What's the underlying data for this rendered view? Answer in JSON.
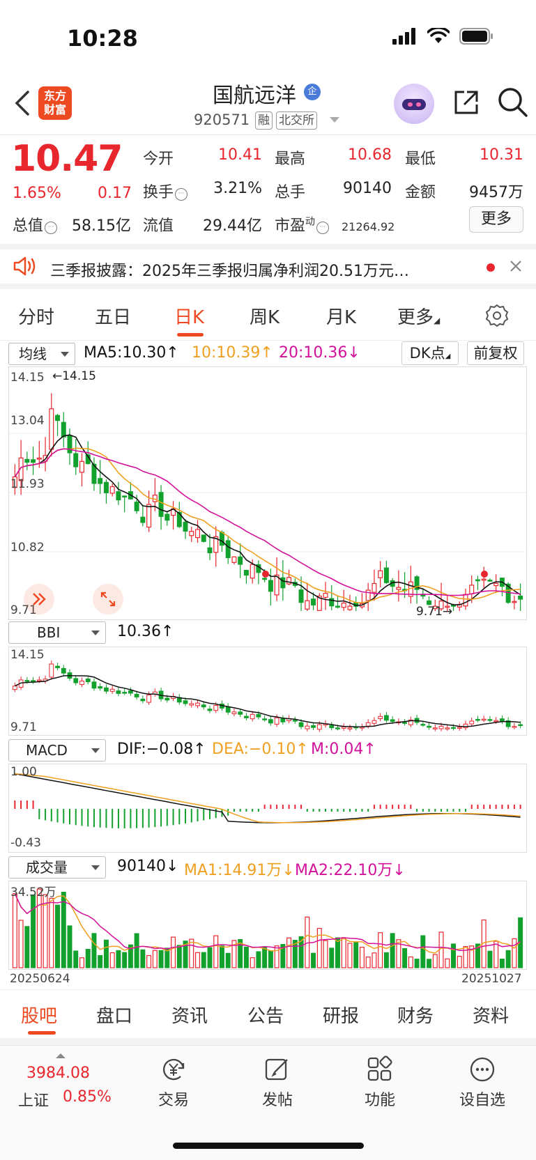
{
  "status": {
    "time": "10:28"
  },
  "header": {
    "brand": [
      "东方",
      "财富"
    ],
    "stock_name": "国航远洋",
    "badge": "企",
    "code": "920571",
    "tags": [
      "融",
      "北交所"
    ]
  },
  "quote": {
    "price": "10.47",
    "change_pct": "1.65%",
    "change": "0.17",
    "stats": {
      "open_label": "今开",
      "open": "10.41",
      "high_label": "最高",
      "high": "10.68",
      "low_label": "最低",
      "low": "10.31",
      "turnover_label": "换手",
      "turnover": "3.21%",
      "volume_label": "总手",
      "volume": "90140",
      "amount_label": "金额",
      "amount": "9457万",
      "mktcap_label": "总值",
      "mktcap": "58.15亿",
      "float_label": "流值",
      "float": "29.44亿",
      "pe_label": "市盈",
      "pe_sup": "动",
      "pe": "21264.92"
    },
    "more_label": "更多"
  },
  "notice": {
    "text": "三季报披露：2025年三季报归属净利润20.51万元…"
  },
  "tabs": [
    "分时",
    "五日",
    "日K",
    "周K",
    "月K",
    "更多"
  ],
  "kline": {
    "selector": "均线",
    "ma5": "MA5:10.30↑",
    "ma10": "10:10.39↑",
    "ma20": "20:10.36↓",
    "dk_label": "DK点",
    "adjust_label": "前复权",
    "axis": [
      "14.15",
      "13.04",
      "11.93",
      "10.82",
      "9.71"
    ],
    "high_marker": "←14.15",
    "low_marker": "9.71→"
  },
  "bbi": {
    "selector": "BBI",
    "value": "10.36↑",
    "axis_top": "14.15",
    "axis_bottom": "9.71"
  },
  "macd": {
    "selector": "MACD",
    "dif": "DIF:−0.08↑",
    "dea": "DEA:−0.10↑",
    "m": "M:0.04↑",
    "axis_top": "1.00",
    "axis_bottom": "-0.43"
  },
  "volume": {
    "selector": "成交量",
    "value": "90140↓",
    "ma1": "MA1:14.91万↓",
    "ma2": "MA2:22.10万↓",
    "axis_top": "34.52万",
    "date_start": "20250624",
    "date_end": "20251027"
  },
  "colors": {
    "up": "#e8262d",
    "down": "#12a12c",
    "accent": "#ee4a22",
    "ma10": "#f0a020",
    "ma20": "#d2119a"
  },
  "bottom_tabs": [
    "股吧",
    "盘口",
    "资讯",
    "公告",
    "研报",
    "财务",
    "资料"
  ],
  "dock": {
    "index_value": "3984.08",
    "index_name": "上证",
    "index_pct": "0.85%",
    "items": [
      "交易",
      "发帖",
      "功能",
      "设自选"
    ]
  }
}
